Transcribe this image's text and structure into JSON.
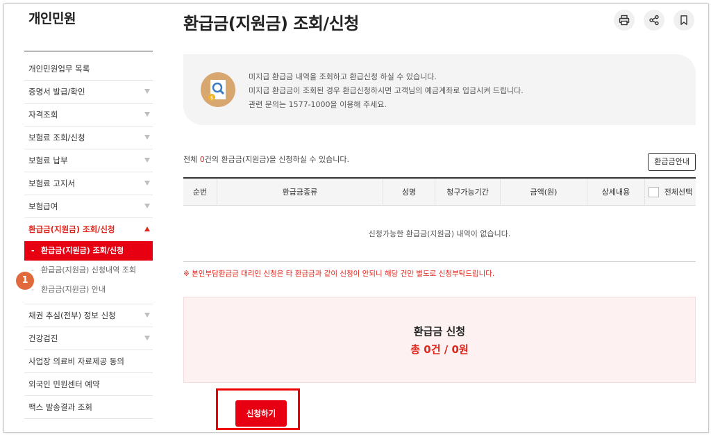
{
  "sidebar": {
    "title": "개인민원",
    "items": [
      {
        "label": "개인민원업무 목록",
        "arrow": false
      },
      {
        "label": "증명서 발급/확인",
        "arrow": true
      },
      {
        "label": "자격조회",
        "arrow": true
      },
      {
        "label": "보험료 조회/신청",
        "arrow": true
      },
      {
        "label": "보험료 납부",
        "arrow": true
      },
      {
        "label": "보험료 고지서",
        "arrow": true
      },
      {
        "label": "보험급여",
        "arrow": true
      },
      {
        "label": "환급금(지원금) 조회/신청",
        "arrow": true,
        "active": true
      }
    ],
    "subitems": [
      {
        "label": "환급금(지원금) 조회/신청",
        "selected": true
      },
      {
        "label": "환급금(지원금) 신청내역 조회"
      },
      {
        "label": "환급금(지원금) 안내"
      }
    ],
    "items_after": [
      {
        "label": "채권 추심(전부) 정보 신청",
        "arrow": true
      },
      {
        "label": "건강검진",
        "arrow": true
      },
      {
        "label": "사업장 의료비 자료제공 동의",
        "arrow": false
      },
      {
        "label": "외국인 민원센터 예약",
        "arrow": false
      },
      {
        "label": "팩스 발송결과 조회",
        "arrow": false
      }
    ],
    "step_badge": "1",
    "dash": "-"
  },
  "page": {
    "title": "환급금(지원금) 조회/신청",
    "tools": [
      "printer-icon",
      "share-icon",
      "bookmark-icon"
    ]
  },
  "info": {
    "icon": "money-search-icon",
    "lines": [
      "미지급 환급금 내역을 조회하고 환급신청 하실 수 있습니다.",
      "미지급 환급금이 조회된 경우 환급신청하시면 고객님의 예금계좌로 입금시켜 드립니다.",
      "관련 문의는 1577-1000을 이용해 주세요."
    ]
  },
  "summary": {
    "prefix": "전체 ",
    "count": "0",
    "suffix": "건의 환급금(지원금)을 신청하실 수 있습니다.",
    "guide_button": "환급금안내"
  },
  "table": {
    "headers": [
      "순번",
      "환급금종류",
      "성명",
      "청구가능기간",
      "금액(원)",
      "상세내용",
      "전체선택"
    ],
    "empty_message": "신청가능한 환급금(지원금) 내역이 없습니다."
  },
  "notice": "※ 본인부담환급금 대리인 신청은 타 환급금과 같이 신청이 안되니 해당 건만 별도로 신청부탁드립니다.",
  "apply": {
    "title": "환급금 신청",
    "total": "총 0건 / 0원",
    "button": "신청하기"
  },
  "colors": {
    "accent": "#e60012",
    "badge": "#e06a3c",
    "info_bg": "#f4f4f4",
    "apply_bg": "#fdf1f1"
  }
}
